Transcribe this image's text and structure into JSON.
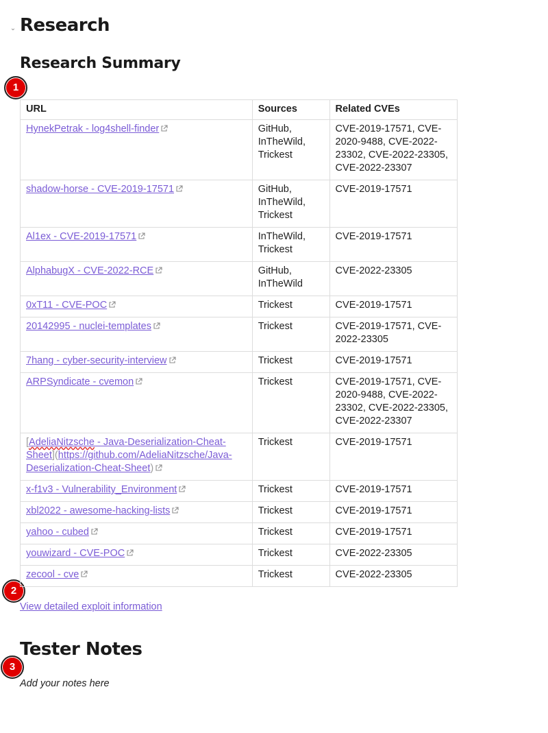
{
  "section": {
    "title": "Research"
  },
  "summary": {
    "title": "Research Summary"
  },
  "markers": [
    "1",
    "2",
    "3"
  ],
  "table": {
    "headers": [
      "URL",
      "Sources",
      "Related CVEs"
    ],
    "rows": [
      {
        "url": "HynekPetrak - log4shell-finder",
        "sources": "GitHub, InTheWild, Trickest",
        "cves": "CVE-2019-17571, CVE-2020-9488, CVE-2022-23302, CVE-2022-23305, CVE-2022-23307"
      },
      {
        "url": "shadow-horse - CVE-2019-17571",
        "sources": "GitHub, InTheWild, Trickest",
        "cves": "CVE-2019-17571"
      },
      {
        "url": "Al1ex - CVE-2019-17571",
        "sources": "InTheWild, Trickest",
        "cves": "CVE-2019-17571"
      },
      {
        "url": "AlphabugX - CVE-2022-RCE",
        "sources": "GitHub, InTheWild",
        "cves": "CVE-2022-23305"
      },
      {
        "url": "0xT11 - CVE-POC",
        "sources": "Trickest",
        "cves": "CVE-2019-17571"
      },
      {
        "url": "20142995 - nuclei-templates",
        "sources": "Trickest",
        "cves": "CVE-2019-17571, CVE-2022-23305"
      },
      {
        "url": "7hang - cyber-security-interview",
        "sources": "Trickest",
        "cves": "CVE-2019-17571"
      },
      {
        "url": "ARPSyndicate - cvemon",
        "sources": "Trickest",
        "cves": "CVE-2019-17571, CVE-2020-9488, CVE-2022-23302, CVE-2022-23305, CVE-2022-23307"
      },
      {
        "url": "",
        "sources": "Trickest",
        "cves": "CVE-2019-17571"
      },
      {
        "url": "x-f1v3 - Vulnerability_Environment",
        "sources": "Trickest",
        "cves": "CVE-2019-17571"
      },
      {
        "url": "xbl2022 - awesome-hacking-lists",
        "sources": "Trickest",
        "cves": "CVE-2019-17571"
      },
      {
        "url": "yahoo - cubed",
        "sources": "Trickest",
        "cves": "CVE-2019-17571"
      },
      {
        "url": "youwizard - CVE-POC",
        "sources": "Trickest",
        "cves": "CVE-2022-23305"
      },
      {
        "url": "zecool - cve",
        "sources": "Trickest",
        "cves": "CVE-2022-23305"
      }
    ],
    "markdown_row": {
      "open_bracket": "[",
      "name": "AdeliaNitzsche",
      "rest": " - Java-Deserialization-Cheat-Sheet",
      "mid": "](",
      "href": "https://github.com/AdeliaNitzsche/Java-Deserialization-Cheat-Sheet",
      "close": ")"
    }
  },
  "detail_link": "View detailed exploit information",
  "notes": {
    "title": "Tester Notes",
    "placeholder": "Add your notes here"
  },
  "colors": {
    "link": "#7b5cd6",
    "marker": "#e00000",
    "border": "#dcdcdc"
  }
}
